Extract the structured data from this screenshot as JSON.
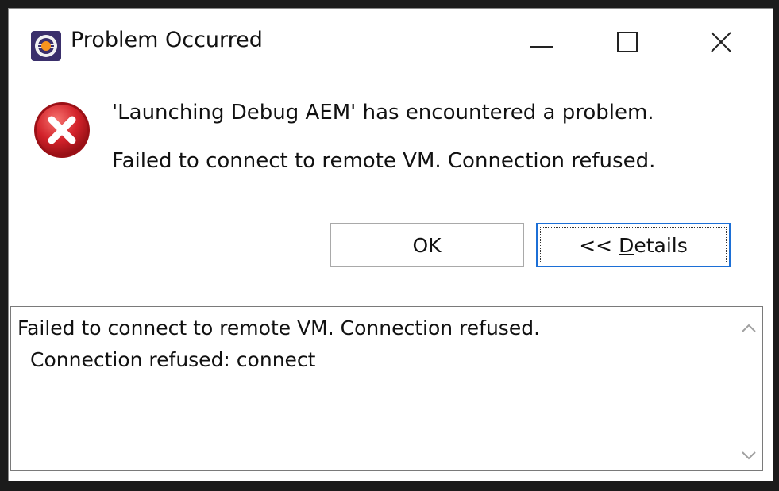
{
  "window": {
    "title": "Problem Occurred",
    "app_icon": "eclipse-icon",
    "controls": {
      "minimize_icon": "minimize-icon",
      "maximize_icon": "maximize-icon",
      "close_icon": "close-icon"
    }
  },
  "message": {
    "icon": "error-icon",
    "primary": "'Launching Debug AEM' has encountered a problem.",
    "secondary": "Failed to connect to remote VM. Connection refused."
  },
  "buttons": {
    "ok_label": "OK",
    "details_label_prefix": "<< ",
    "details_label_mnemonic": "D",
    "details_label_rest": "etails"
  },
  "details": {
    "lines": [
      "Failed to connect to remote VM. Connection refused.",
      "Connection refused: connect"
    ]
  },
  "colors": {
    "focus_border": "#1c6fd6",
    "error_red": "#c8161d"
  }
}
